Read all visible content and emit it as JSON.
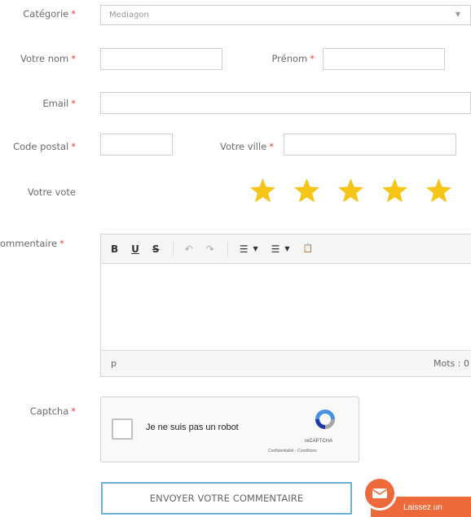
{
  "form": {
    "category": {
      "label": "Catégorie",
      "value": "Mediagon"
    },
    "last_name": {
      "label": "Votre nom",
      "value": ""
    },
    "first_name": {
      "label": "Prénom",
      "value": ""
    },
    "email": {
      "label": "Email",
      "value": ""
    },
    "postal_code": {
      "label": "Code postal",
      "value": ""
    },
    "city": {
      "label": "Votre ville",
      "value": ""
    },
    "vote": {
      "label": "Votre vote",
      "stars": 5,
      "max": 5
    },
    "comment": {
      "label": "ommentaire",
      "toolbar": {
        "bold": "B",
        "underline": "U",
        "strike": "S",
        "undo": "↶",
        "redo": "↷",
        "bullets": "☰",
        "numbered": "☰",
        "paste": "📋"
      },
      "status_path": "p",
      "word_count_label": "Mots : 0"
    },
    "captcha": {
      "label": "Captcha",
      "checkbox_text": "Je ne suis pas un robot",
      "brand": "reCAPTCHA",
      "links": "Confidentialité - Conditions"
    },
    "submit_label": "ENVOYER VOTRE COMMENTAIRE",
    "required_marker": "*",
    "select_arrow": "▼"
  },
  "feedback_tab": {
    "label": "Laissez un"
  },
  "colors": {
    "accent": "#ef6a3a",
    "star": "#f5c518",
    "required": "#e2463d",
    "submit_border": "#6ab3d3"
  }
}
